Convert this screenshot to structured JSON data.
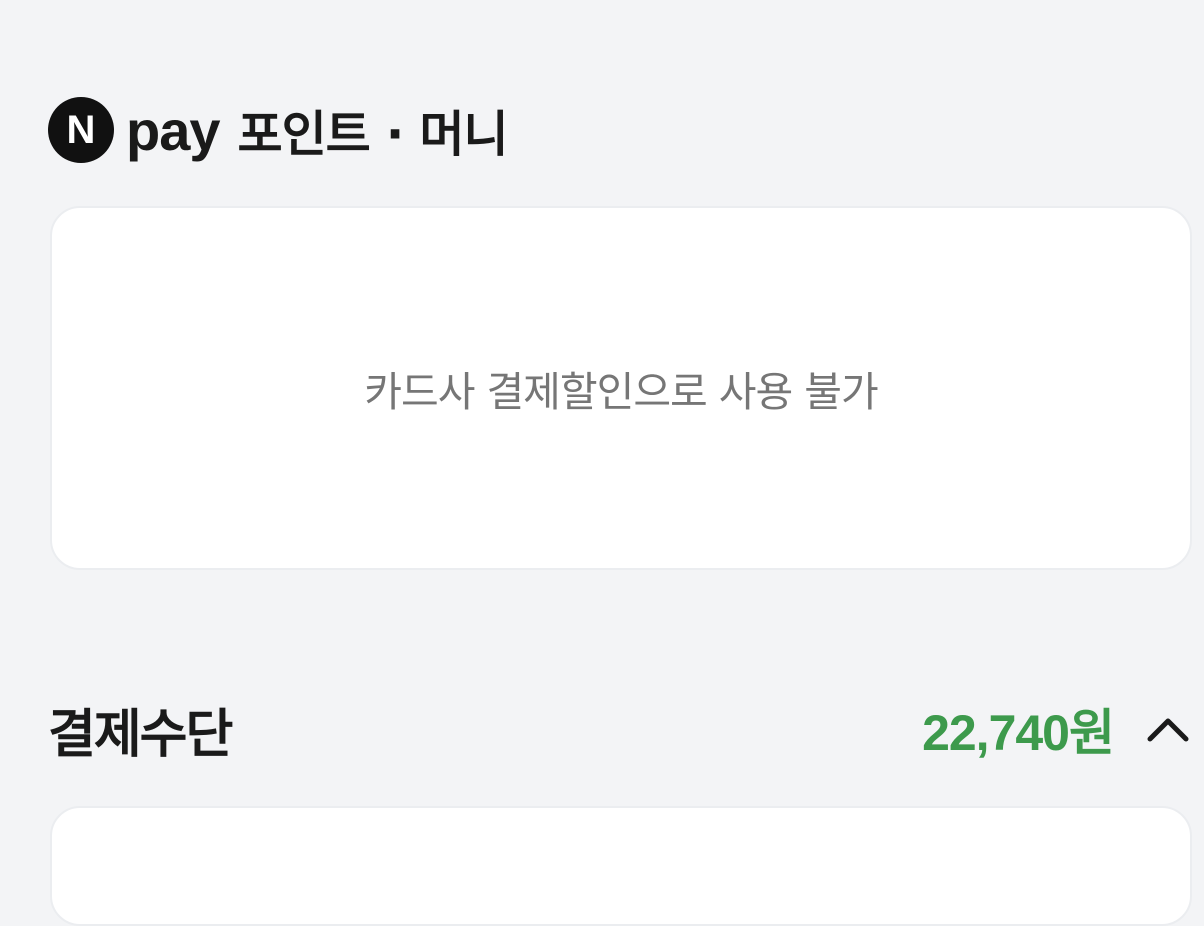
{
  "points_section": {
    "logo_letter": "N",
    "logo_word": "pay",
    "title": "포인트 · 머니",
    "message": "카드사 결제할인으로 사용 불가"
  },
  "payment_section": {
    "title": "결제수단",
    "amount": "22,740원"
  },
  "icons": {
    "logo": "npay-logo-icon",
    "toggle": "chevron-up-icon"
  },
  "colors": {
    "background": "#f3f4f6",
    "card": "#ffffff",
    "amount_green": "#3d9a4c",
    "logo_black": "#111111"
  }
}
